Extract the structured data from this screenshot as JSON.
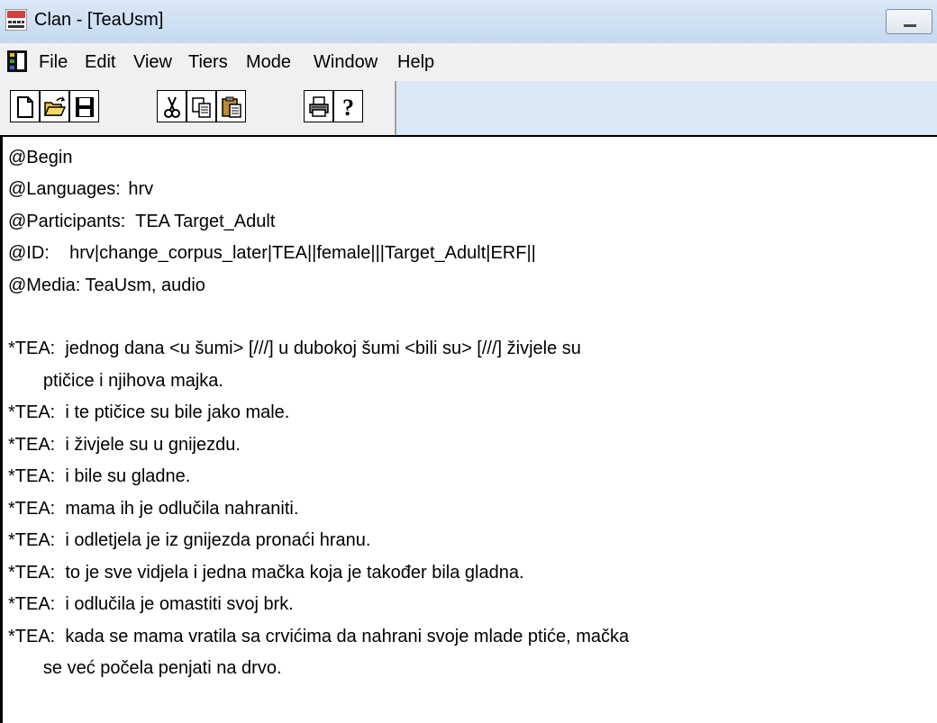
{
  "window": {
    "title": "Clan - [TeaUsm]"
  },
  "menu": {
    "file": "File",
    "edit": "Edit",
    "view": "View",
    "tiers": "Tiers",
    "mode": "Mode",
    "window": "Window",
    "help": "Help"
  },
  "toolbar": {
    "icons": [
      "new-file-icon",
      "open-folder-icon",
      "save-icon",
      "cut-icon",
      "copy-icon",
      "paste-icon",
      "print-icon",
      "help-icon"
    ]
  },
  "document": {
    "headers": [
      "@Begin",
      "@Languages:\thrv",
      "@Participants:  TEA Target_Adult",
      "@ID:    hrv|change_corpus_later|TEA||female|||Target_Adult|ERF||",
      "@Media: TeaUsm, audio"
    ],
    "utterances": [
      "*TEA:  jednog dana <u šumi> [///] u dubokoj šumi <bili su> [///] živjele su",
      "       ptičice i njihova majka.",
      "*TEA:  i te ptičice su bile jako male.",
      "*TEA:  i živjele su u gnijezdu.",
      "*TEA:  i bile su gladne.",
      "*TEA:  mama ih je odlučila nahraniti.",
      "*TEA:  i odletjela je iz gnijezda pronaći hranu.",
      "*TEA:  to je sve vidjela i jedna mačka koja je također bila gladna.",
      "*TEA:  i odlučila je omastiti svoj brk.",
      "*TEA:  kada se mama vratila sa crvićima da nahrani svoje mlade ptiće, mačka",
      "       se već počela penjati na drvo."
    ]
  }
}
